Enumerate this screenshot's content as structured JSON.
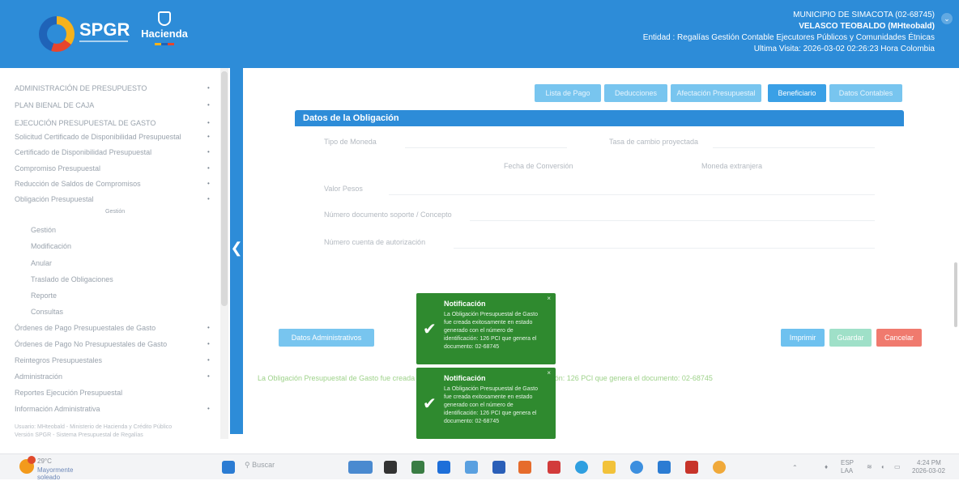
{
  "header": {
    "logo_text": "SPGR",
    "logo2_text": "Hacienda",
    "line1": "MUNICIPIO DE SIMACOTA (02-68745)",
    "line2": "VELASCO TEOBALDO (MHteobald)",
    "line3": "Entidad : Regalías Gestión Contable Ejecutores Públicos y Comunidades Étnicas",
    "line4": "Ultima Visita: 2026-03-02 02:26:23 Hora Colombia"
  },
  "sidebar": {
    "items": [
      {
        "label": "ADMINISTRACIÓN DE PRESUPUESTO",
        "arrow": "•"
      },
      {
        "label": "PLAN BIENAL DE CAJA",
        "arrow": "•"
      },
      {
        "label": "EJECUCIÓN PRESUPUESTAL DE GASTO",
        "arrow": "•"
      },
      {
        "label": "Solicitud Certificado de Disponibilidad Presupuestal",
        "arrow": "•"
      },
      {
        "label": "Certificado de Disponibilidad Presupuestal",
        "arrow": "•"
      },
      {
        "label": "Compromiso Presupuestal",
        "arrow": "•"
      },
      {
        "label": "Reducción de Saldos de Compromisos",
        "arrow": "•"
      },
      {
        "label": "Obligación Presupuestal",
        "arrow": "•"
      },
      {
        "label": "Gestión",
        "arrow": ""
      },
      {
        "label": "Modificación",
        "arrow": ""
      },
      {
        "label": "Anular",
        "arrow": ""
      },
      {
        "label": "Traslado de Obligaciones",
        "arrow": ""
      },
      {
        "label": "Reporte",
        "arrow": ""
      },
      {
        "label": "Consultas",
        "arrow": ""
      },
      {
        "label": "Órdenes de Pago Presupuestales de Gasto",
        "arrow": "•"
      },
      {
        "label": "Órdenes de Pago No Presupuestales de Gasto",
        "arrow": "•"
      },
      {
        "label": "Reintegros Presupuestales",
        "arrow": "•"
      },
      {
        "label": "Administración",
        "arrow": "•"
      },
      {
        "label": "Reportes Ejecución Presupuestal",
        "arrow": ""
      },
      {
        "label": "Información Administrativa",
        "arrow": "•"
      }
    ],
    "sub_header": "Gestión",
    "footer1": "Usuario: MHteobald - Ministerio de Hacienda y Crédito Público",
    "footer2": "Versión SPGR - Sistema Presupuestal de Regalías"
  },
  "tabs": [
    {
      "label": "Lista de Pago"
    },
    {
      "label": "Deducciones"
    },
    {
      "label": "Afectación Presupuestal"
    },
    {
      "label": "Beneficiario"
    },
    {
      "label": "Datos Contables"
    }
  ],
  "panel": {
    "title": "Datos de la Obligación",
    "f1": "Tipo de Moneda",
    "f2": "Tasa de cambio proyectada",
    "f3": "Fecha de Conversión",
    "f4": "Moneda extranjera",
    "f5": "Valor Pesos",
    "f6": "Número documento soporte / Concepto",
    "f7": "Número cuenta de autorización"
  },
  "buttons": {
    "admin": "Datos Administrativos",
    "print": "Imprimir",
    "save": "Guardar",
    "cancel": "Cancelar"
  },
  "message": "La Obligación Presupuestal de Gasto fue creada exitosamente con el número de identificación: 126 PCI que genera el documento: 02-68745",
  "notifications": [
    {
      "title": "Notificación",
      "body": "La Obligación Presupuestal de Gasto fue creada exitosamente en estado generado con el número de identificación: 126 PCI que genera el documento: 02-68745",
      "close": "×"
    },
    {
      "title": "Notificación",
      "body": "La Obligación Presupuestal de Gasto fue creada exitosamente en estado generado con el número de identificación: 126 PCI que genera el documento: 02-68745",
      "close": "×"
    }
  ],
  "taskbar": {
    "temp": "29°C",
    "weather": "Mayormente soleado",
    "search": "Buscar",
    "lang1": "ESP",
    "lang2": "LAA",
    "time": "4:24 PM",
    "date": "2026-03-02"
  },
  "colors": {
    "header": "#2d8cd8",
    "tab": "#78c5ef",
    "tab_active": "#3aa0e6",
    "notification": "#2f8a2f",
    "cancel": "#f07a6e",
    "save": "#9fe0c8",
    "print": "#6ec1ef"
  }
}
